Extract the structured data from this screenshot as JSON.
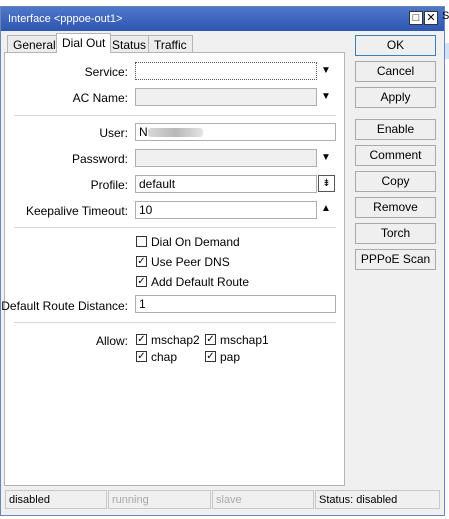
{
  "window": {
    "title": "Interface <pppoe-out1>",
    "maximize_glyph": "□",
    "close_glyph": "✕",
    "peek_text": "S"
  },
  "tabs": [
    {
      "label": "General",
      "active": false
    },
    {
      "label": "Dial Out",
      "active": true
    },
    {
      "label": "Status",
      "active": false
    },
    {
      "label": "Traffic",
      "active": false
    }
  ],
  "form": {
    "service": {
      "label": "Service:",
      "value": ""
    },
    "ac_name": {
      "label": "AC Name:",
      "value": ""
    },
    "user": {
      "label": "User:",
      "value": "N"
    },
    "password": {
      "label": "Password:",
      "value": ""
    },
    "profile": {
      "label": "Profile:",
      "value": "default"
    },
    "keepalive": {
      "label": "Keepalive Timeout:",
      "value": "10"
    },
    "dial_on_demand": {
      "label": "Dial On Demand",
      "checked": false
    },
    "use_peer_dns": {
      "label": "Use Peer DNS",
      "checked": true
    },
    "add_default_route": {
      "label": "Add Default Route",
      "checked": true
    },
    "default_route_distance": {
      "label": "Default Route Distance:",
      "value": "1"
    },
    "allow": {
      "label": "Allow:",
      "mschap2": {
        "label": "mschap2",
        "checked": true
      },
      "mschap1": {
        "label": "mschap1",
        "checked": true
      },
      "chap": {
        "label": "chap",
        "checked": true
      },
      "pap": {
        "label": "pap",
        "checked": true
      }
    }
  },
  "icons": {
    "dropdown": "▼",
    "stepper": "▲",
    "combo": "⇟",
    "check": "✓"
  },
  "buttons": {
    "ok": "OK",
    "cancel": "Cancel",
    "apply": "Apply",
    "enable": "Enable",
    "comment": "Comment",
    "copy": "Copy",
    "remove": "Remove",
    "torch": "Torch",
    "pppoe_scan": "PPPoE Scan"
  },
  "statusbar": {
    "state": "disabled",
    "running": "running",
    "slave": "slave",
    "status": "Status: disabled"
  }
}
